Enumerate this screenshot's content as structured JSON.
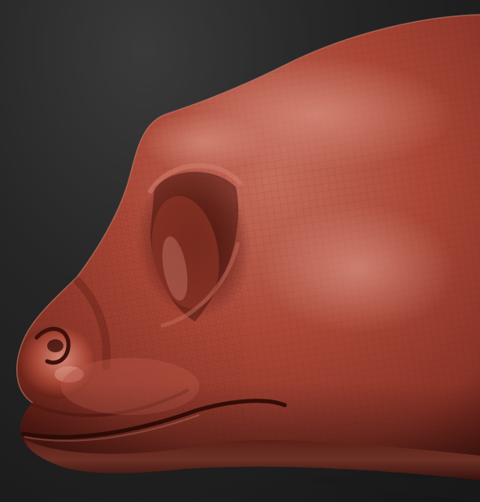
{
  "scene": {
    "subject": "",
    "colors": {
      "background_top": "#3a3a3a",
      "background_bottom": "#151515",
      "skin_base": "#9e3f30",
      "skin_highlight": "#d98a78",
      "skin_shadow": "#4a1610",
      "wire": "#6e2a1f"
    }
  }
}
